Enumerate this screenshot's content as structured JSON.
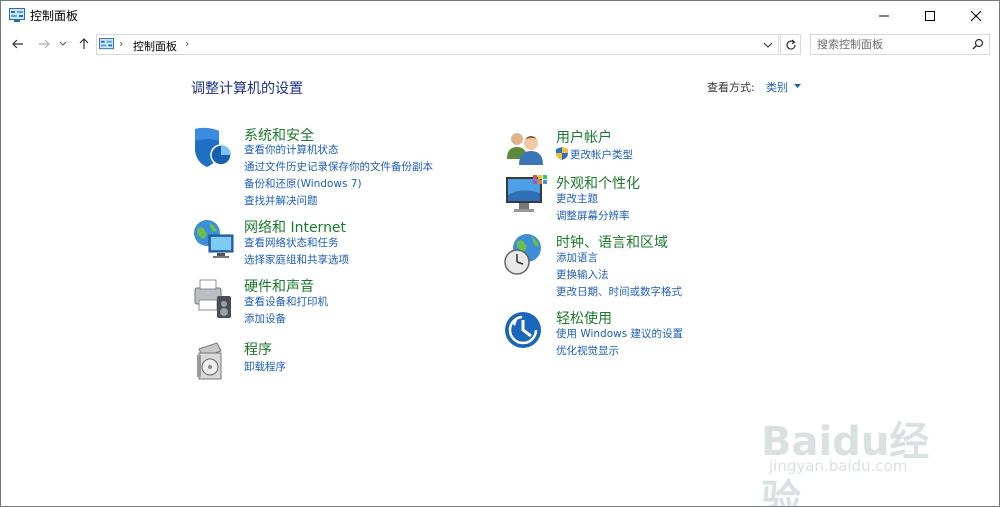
{
  "window": {
    "title": "控制面板"
  },
  "address": {
    "crumbs": [
      "控制面板"
    ],
    "search_placeholder": "搜索控制面板"
  },
  "content": {
    "heading": "调整计算机的设置",
    "view_by_label": "查看方式:",
    "view_by_value": "类别"
  },
  "categories": {
    "system_security": {
      "title": "系统和安全",
      "links": [
        "查看你的计算机状态",
        "通过文件历史记录保存你的文件备份副本",
        "备份和还原(Windows 7)",
        "查找并解决问题"
      ]
    },
    "network": {
      "title": "网络和 Internet",
      "links": [
        "查看网络状态和任务",
        "选择家庭组和共享选项"
      ]
    },
    "hardware": {
      "title": "硬件和声音",
      "links": [
        "查看设备和打印机",
        "添加设备"
      ]
    },
    "programs": {
      "title": "程序",
      "links": [
        "卸载程序"
      ]
    },
    "user_accounts": {
      "title": "用户帐户",
      "links": [
        "更改帐户类型"
      ]
    },
    "appearance": {
      "title": "外观和个性化",
      "links": [
        "更改主题",
        "调整屏幕分辨率"
      ]
    },
    "clock": {
      "title": "时钟、语言和区域",
      "links": [
        "添加语言",
        "更换输入法",
        "更改日期、时间或数字格式"
      ]
    },
    "ease": {
      "title": "轻松使用",
      "links": [
        "使用 Windows 建议的设置",
        "优化视觉显示"
      ]
    }
  },
  "watermark": {
    "text": "Baidu经验",
    "sub": "jingyan.baidu.com"
  },
  "colors": {
    "category_title": "#1c7a2c",
    "link": "#1e5eb8",
    "heading": "#1e3287"
  }
}
